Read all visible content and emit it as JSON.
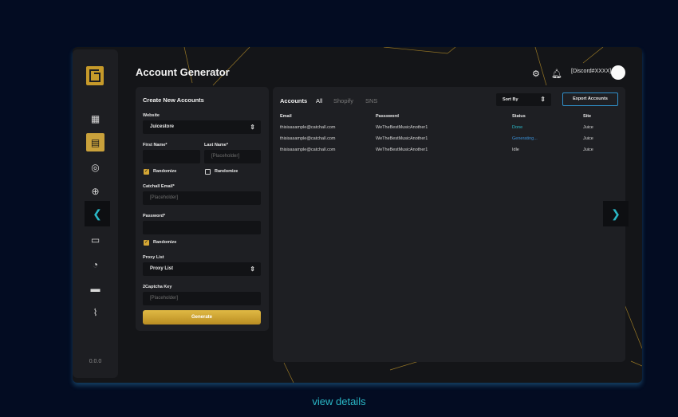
{
  "app": {
    "title": "Account Generator",
    "user": "[Discord#XXXX]",
    "version": "0.0.0"
  },
  "sidebar": {
    "items": [
      {
        "icon": "grid-icon",
        "glyph": "▦"
      },
      {
        "icon": "accounts-icon",
        "glyph": "▤"
      },
      {
        "icon": "proxy-globe-icon",
        "glyph": "◎"
      },
      {
        "icon": "globe-icon",
        "glyph": "⊕"
      },
      {
        "icon": "collapse-icon",
        "glyph": "❮"
      },
      {
        "icon": "briefcase-icon",
        "glyph": "▭"
      },
      {
        "icon": "gauge-icon",
        "glyph": "◔"
      },
      {
        "icon": "card-icon",
        "glyph": "▬"
      },
      {
        "icon": "analytics-icon",
        "glyph": "⌇"
      }
    ]
  },
  "form": {
    "title": "Create New Accounts",
    "website_label": "Website",
    "website_value": "Juicestore",
    "first_name_label": "First Name*",
    "last_name_label": "Last Name*",
    "last_name_placeholder": "[Placeholder]",
    "randomize_label": "Randomize",
    "catchall_label": "Catchall Email*",
    "catchall_placeholder": "[Placeholder]",
    "password_label": "Password*",
    "proxy_label": "Proxy List",
    "proxy_value": "Proxy List",
    "captcha_label": "2Captcha Key",
    "captcha_placeholder": "[Placeholder]",
    "generate_label": "Generate",
    "randomize_states": {
      "first_name": true,
      "last_name": false,
      "password": true
    }
  },
  "accounts": {
    "tabs": [
      "Accounts",
      "All",
      "Shopify",
      "SNS"
    ],
    "sort_label": "Sort By",
    "export_label": "Export Accounts",
    "columns": [
      "Email",
      "Passsword",
      "Status",
      "Site"
    ],
    "rows": [
      {
        "email": "thisisasample@catchall.com",
        "password": "WeTheBestMusicAnother1",
        "status": "Done",
        "site": "Juice"
      },
      {
        "email": "thisisasample@catchall.com",
        "password": "WeTheBestMusicAnother1",
        "status": "Generating...",
        "site": "Juice"
      },
      {
        "email": "thisisasample@catchall.com",
        "password": "WeTheBestMusicAnother1",
        "status": "Idle",
        "site": "Juice"
      }
    ]
  },
  "footer": {
    "link": "view details"
  },
  "colors": {
    "accent_gold": "#c9a13b",
    "accent_teal": "#2ab7c6",
    "status_done": "#2bb9c9",
    "status_generating": "#3a8fd6"
  }
}
